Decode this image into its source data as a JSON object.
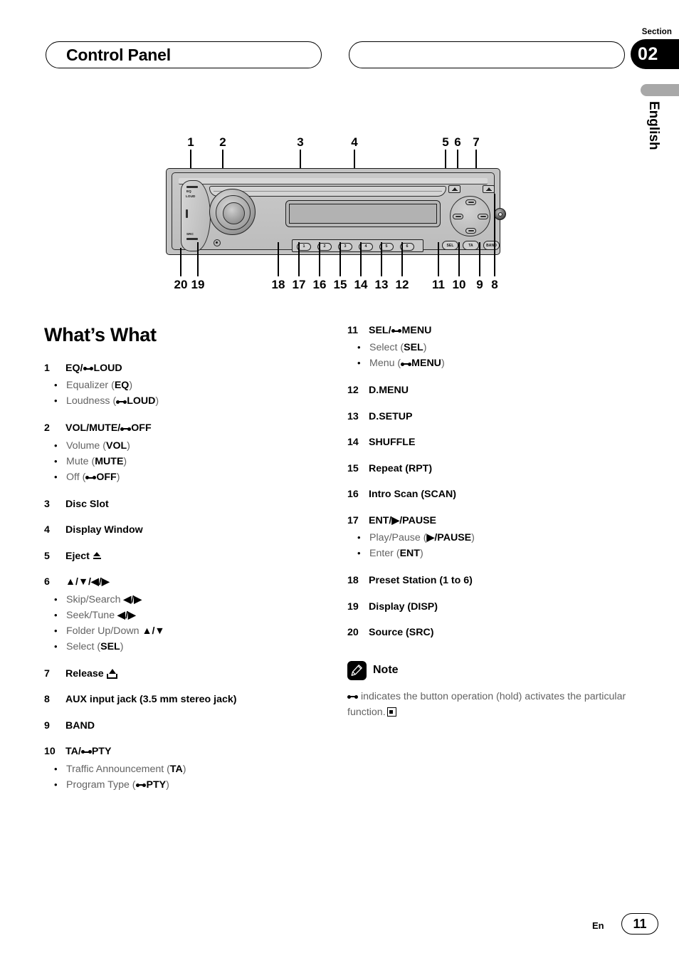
{
  "header": {
    "title": "Control Panel",
    "section_label": "Section",
    "section_number": "02",
    "language": "English"
  },
  "diagram": {
    "caption_numbers_top": [
      "1",
      "2",
      "3",
      "4",
      "5",
      "6",
      "7"
    ],
    "caption_numbers_bottom": [
      "20",
      "19",
      "18",
      "17",
      "16",
      "15",
      "14",
      "13",
      "12",
      "11",
      "10",
      "9",
      "8"
    ],
    "faceplate": {
      "left_plate_labels": [
        "EQ",
        "LOUD",
        "SRC"
      ],
      "preset_buttons": [
        "1",
        "2",
        "3",
        "4",
        "5",
        "6"
      ],
      "function_buttons": [
        "SEL",
        "TA",
        "BAND"
      ]
    }
  },
  "main": {
    "heading": "What’s What",
    "left_entries": [
      {
        "num": "1",
        "title_parts": [
          {
            "t": "EQ/",
            "b": true
          },
          {
            "hold": true
          },
          {
            "t": "LOUD",
            "b": true
          }
        ],
        "subs": [
          [
            {
              "t": "Equalizer ("
            },
            {
              "t": "EQ",
              "b": true
            },
            {
              "t": ")"
            }
          ],
          [
            {
              "t": "Loudness ("
            },
            {
              "hold": true
            },
            {
              "t": "LOUD",
              "b": true
            },
            {
              "t": ")"
            }
          ]
        ]
      },
      {
        "num": "2",
        "title_parts": [
          {
            "t": "VOL/MUTE/",
            "b": true
          },
          {
            "hold": true
          },
          {
            "t": "OFF",
            "b": true
          }
        ],
        "subs": [
          [
            {
              "t": "Volume ("
            },
            {
              "t": "VOL",
              "b": true
            },
            {
              "t": ")"
            }
          ],
          [
            {
              "t": "Mute ("
            },
            {
              "t": "MUTE",
              "b": true
            },
            {
              "t": ")"
            }
          ],
          [
            {
              "t": "Off ("
            },
            {
              "hold": true
            },
            {
              "t": "OFF",
              "b": true
            },
            {
              "t": ")"
            }
          ]
        ]
      },
      {
        "num": "3",
        "title_parts": [
          {
            "t": "Disc Slot",
            "b": true
          }
        ],
        "subs": []
      },
      {
        "num": "4",
        "title_parts": [
          {
            "t": "Display Window",
            "b": true
          }
        ],
        "subs": []
      },
      {
        "num": "5",
        "title_parts": [
          {
            "t": "Eject ",
            "b": true
          },
          {
            "eject": true
          }
        ],
        "subs": []
      },
      {
        "num": "6",
        "title_parts": [
          {
            "t": "▲/▼/◀/▶",
            "b": true
          }
        ],
        "subs": [
          [
            {
              "t": "Skip/Search "
            },
            {
              "t": "◀/▶",
              "b": true
            }
          ],
          [
            {
              "t": "Seek/Tune "
            },
            {
              "t": "◀/▶",
              "b": true
            }
          ],
          [
            {
              "t": "Folder Up/Down "
            },
            {
              "t": "▲/▼",
              "b": true
            }
          ],
          [
            {
              "t": "Select ("
            },
            {
              "t": "SEL",
              "b": true
            },
            {
              "t": ")"
            }
          ]
        ]
      },
      {
        "num": "7",
        "title_parts": [
          {
            "t": "Release ",
            "b": true
          },
          {
            "release": true
          }
        ],
        "subs": []
      },
      {
        "num": "8",
        "title_parts": [
          {
            "t": "AUX input jack (3.5 mm stereo jack)",
            "b": true
          }
        ],
        "subs": []
      },
      {
        "num": "9",
        "title_parts": [
          {
            "t": "BAND",
            "b": true
          }
        ],
        "subs": []
      },
      {
        "num": "10",
        "title_parts": [
          {
            "t": "TA/",
            "b": true
          },
          {
            "hold": true
          },
          {
            "t": "PTY",
            "b": true
          }
        ],
        "subs": [
          [
            {
              "t": "Traffic Announcement ("
            },
            {
              "t": "TA",
              "b": true
            },
            {
              "t": ")"
            }
          ],
          [
            {
              "t": "Program Type ("
            },
            {
              "hold": true
            },
            {
              "t": "PTY",
              "b": true
            },
            {
              "t": ")"
            }
          ]
        ]
      }
    ],
    "right_entries": [
      {
        "num": "11",
        "title_parts": [
          {
            "t": "SEL/",
            "b": true
          },
          {
            "hold": true
          },
          {
            "t": "MENU",
            "b": true
          }
        ],
        "subs": [
          [
            {
              "t": "Select ("
            },
            {
              "t": "SEL",
              "b": true
            },
            {
              "t": ")"
            }
          ],
          [
            {
              "t": "Menu ("
            },
            {
              "hold": true
            },
            {
              "t": "MENU",
              "b": true
            },
            {
              "t": ")"
            }
          ]
        ]
      },
      {
        "num": "12",
        "title_parts": [
          {
            "t": "D.MENU",
            "b": true
          }
        ],
        "subs": []
      },
      {
        "num": "13",
        "title_parts": [
          {
            "t": "D.SETUP",
            "b": true
          }
        ],
        "subs": []
      },
      {
        "num": "14",
        "title_parts": [
          {
            "t": "SHUFFLE",
            "b": true
          }
        ],
        "subs": []
      },
      {
        "num": "15",
        "title_parts": [
          {
            "t": "Repeat (RPT)",
            "b": true
          }
        ],
        "subs": []
      },
      {
        "num": "16",
        "title_parts": [
          {
            "t": "Intro Scan (SCAN)",
            "b": true
          }
        ],
        "subs": []
      },
      {
        "num": "17",
        "title_parts": [
          {
            "t": "ENT/▶/PAUSE",
            "b": true
          }
        ],
        "subs": [
          [
            {
              "t": "Play/Pause ("
            },
            {
              "t": "▶/PAUSE",
              "b": true
            },
            {
              "t": ")"
            }
          ],
          [
            {
              "t": "Enter ("
            },
            {
              "t": "ENT",
              "b": true
            },
            {
              "t": ")"
            }
          ]
        ]
      },
      {
        "num": "18",
        "title_parts": [
          {
            "t": "Preset Station (1 to 6)",
            "b": true
          }
        ],
        "subs": []
      },
      {
        "num": "19",
        "title_parts": [
          {
            "t": "Display (DISP)",
            "b": true
          }
        ],
        "subs": []
      },
      {
        "num": "20",
        "title_parts": [
          {
            "t": "Source (SRC)",
            "b": true
          }
        ],
        "subs": []
      }
    ],
    "note": {
      "title": "Note",
      "icon": "pencil-icon",
      "body_parts": [
        {
          "hold": true
        },
        {
          "t": " indicates the button operation (hold) activates the particular function."
        },
        {
          "eos": true
        }
      ]
    }
  },
  "footer": {
    "language_code": "En",
    "page_number": "11"
  }
}
